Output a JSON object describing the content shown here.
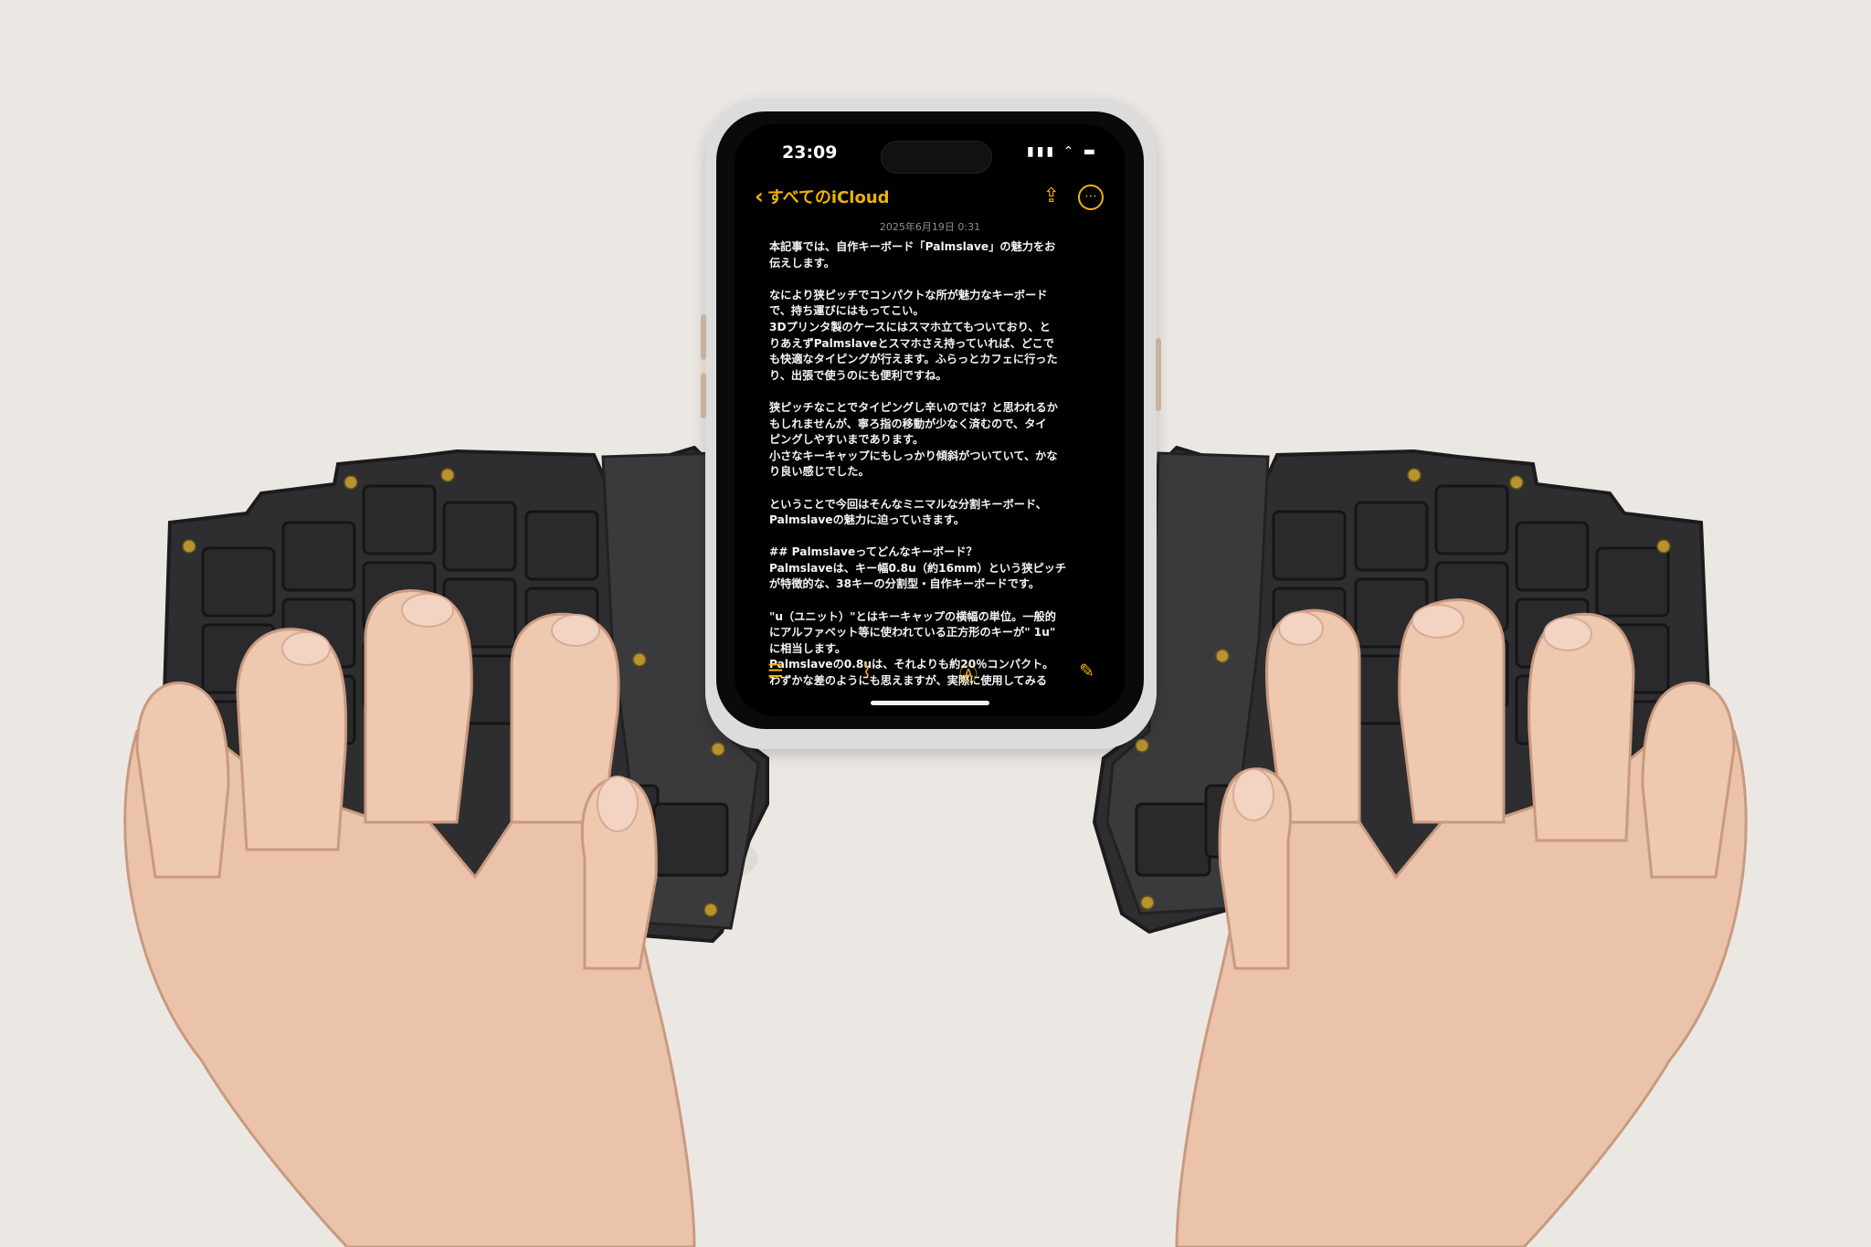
{
  "phone": {
    "status_time": "23:09",
    "status_icons": "▮▮▮ ⌃ ▬",
    "back_label": "すべてのiCloud",
    "share_icon": "share-icon",
    "more_icon": "ellipsis-circle-icon",
    "note_date": "2025年6月19日 0:31",
    "note_lines": [
      "本記事では、自作キーボード「Palmslave」の魅力をお",
      "伝えします。",
      "",
      "なにより狭ピッチでコンパクトな所が魅力なキーボード",
      "で、持ち運びにはもってこい。",
      "3Dプリンタ製のケースにはスマホ立てもついており、と",
      "りあえずPalmslaveとスマホさえ持っていれば、どこで",
      "も快適なタイピングが行えます。ふらっとカフェに行った",
      "り、出張で使うのにも便利ですね。",
      "",
      "狭ピッチなことでタイピングし辛いのでは？と思われるか",
      "もしれませんが、寧ろ指の移動が少なく済むので、タイ",
      "ピングしやすいまであります。",
      "小さなキーキャップにもしっかり傾斜がついていて、かな",
      "り良い感じでした。",
      "",
      "ということで今回はそんなミニマルな分割キーボード、",
      "Palmslaveの魅力に迫っていきます。",
      "",
      "## Palmslaveってどんなキーボード？",
      "Palmslaveは、キー幅0.8u（約16mm）という狭ピッチ",
      "が特徴的な、38キーの分割型・自作キーボードです。",
      "",
      "\"u（ユニット）\"とはキーキャップの横幅の単位。一般的",
      "にアルファベット等に使われている正方形のキーが\" 1u\"",
      "に相当します。",
      "Palmslaveの0.8uは、それよりも約20％コンパクト。",
      "わずかな差のようにも思えますが、実際に使用してみる"
    ],
    "toolbar_icons": [
      "checklist-icon",
      "paperclip-icon",
      "markup-icon",
      "compose-icon"
    ]
  },
  "colors": {
    "accent": "#f0b400",
    "background": "#ebe8e3",
    "keyboard": "#2e2e30",
    "brass": "#b8942e"
  }
}
